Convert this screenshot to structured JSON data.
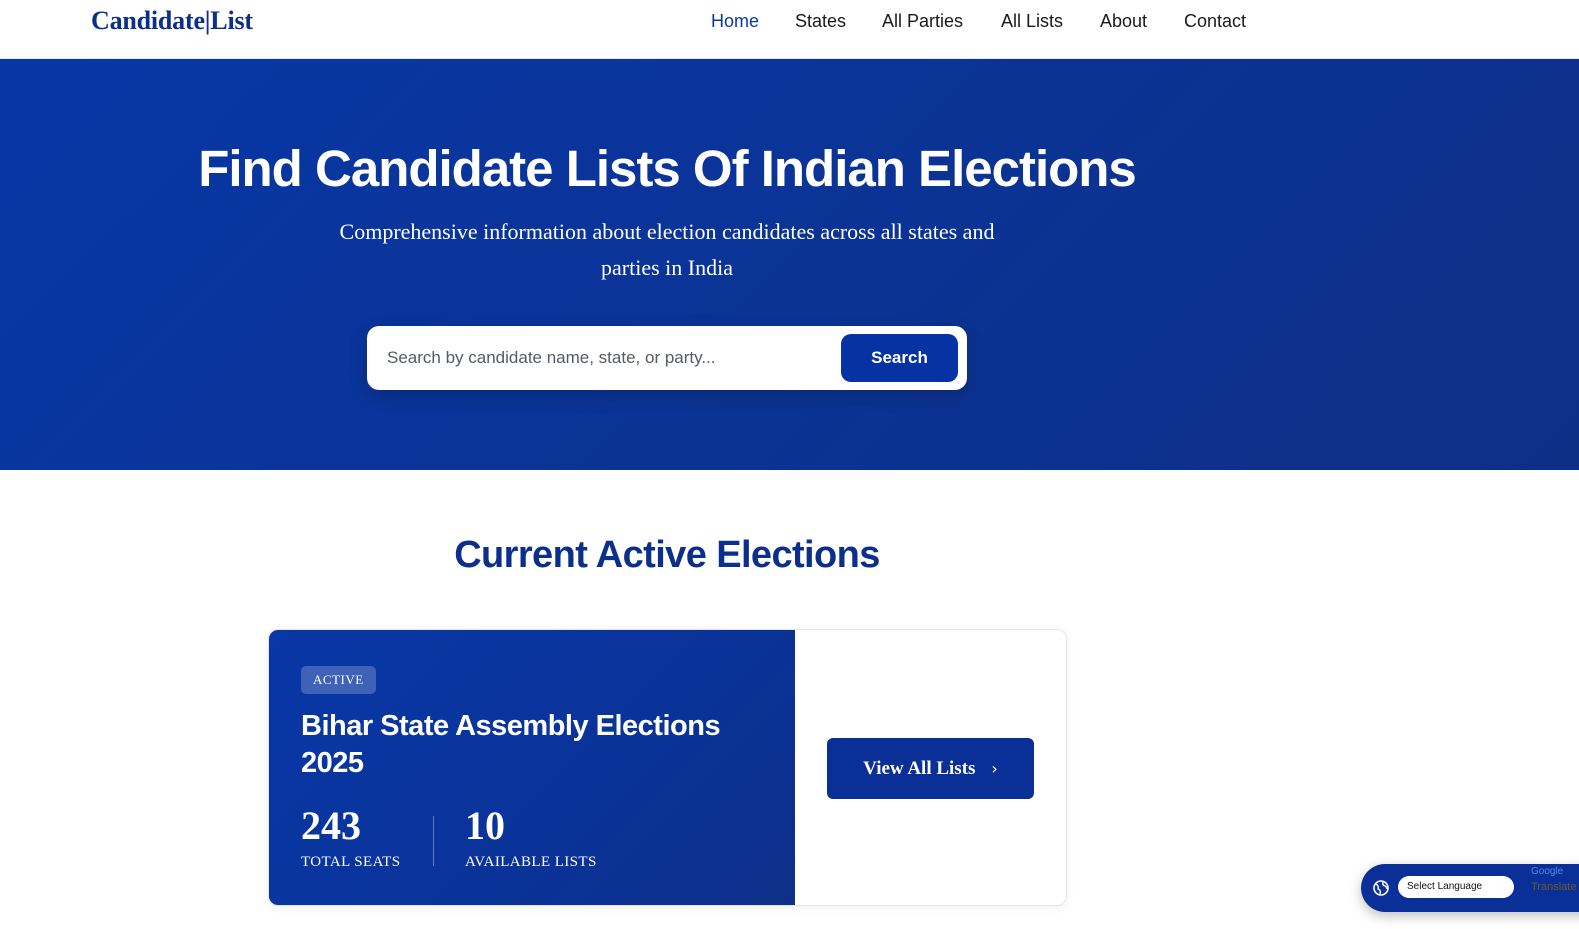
{
  "brand": {
    "logo": "Candidate|List",
    "accent": "#0b2f8a"
  },
  "nav": {
    "items": [
      {
        "label": "Home",
        "active": true
      },
      {
        "label": "States",
        "active": false
      },
      {
        "label": "All Parties",
        "active": false
      },
      {
        "label": "All Lists",
        "active": false
      },
      {
        "label": "About",
        "active": false
      },
      {
        "label": "Contact",
        "active": false
      }
    ]
  },
  "hero": {
    "title": "Find Candidate Lists Of Indian Elections",
    "subtitle": "Comprehensive information about election candidates across all states and parties in India",
    "search": {
      "placeholder": "Search by candidate name, state, or party...",
      "value": "",
      "button_label": "Search"
    },
    "background_color": "#0b3394"
  },
  "active_elections": {
    "section_title": "Current Active Elections",
    "cards": [
      {
        "badge": "ACTIVE",
        "title": "Bihar State Assembly Elections 2025",
        "stats": [
          {
            "value": "243",
            "label": "TOTAL SEATS"
          },
          {
            "value": "10",
            "label": "AVAILABLE LISTS"
          }
        ],
        "button_label": "View All Lists",
        "button_icon": "chevron-right-icon"
      }
    ]
  },
  "translate_widget": {
    "select_label": "Select Language",
    "google_label": "Google",
    "translate_label": "Translate",
    "icon": "globe-icon"
  }
}
